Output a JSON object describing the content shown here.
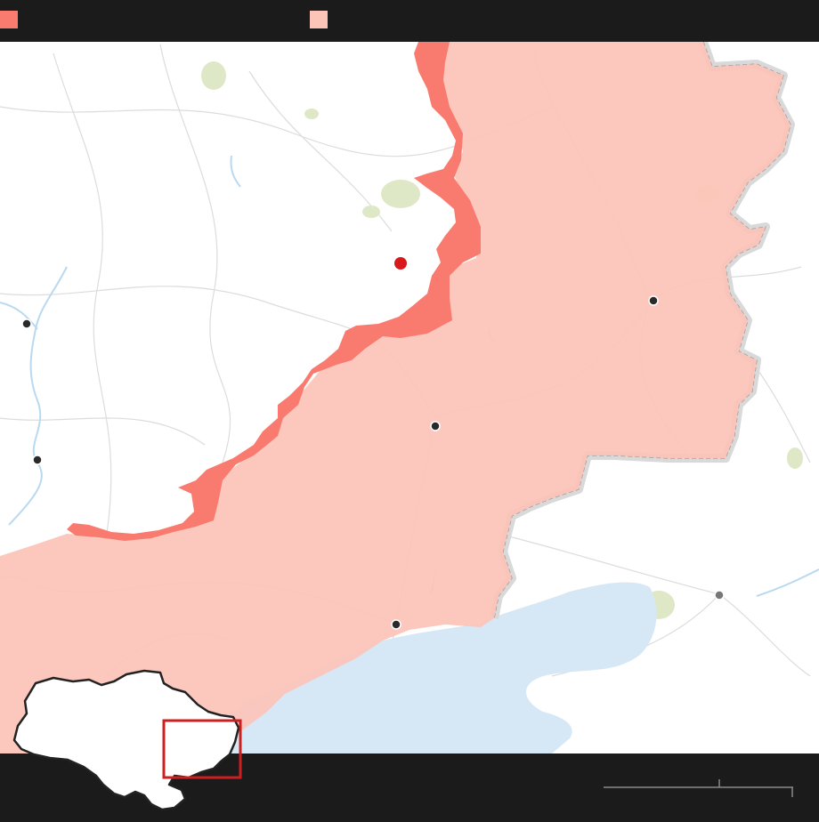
{
  "legend": {
    "items": [
      {
        "label": "",
        "color": "#f97b6f"
      },
      {
        "label": "",
        "color": "#fcc3b7"
      }
    ]
  },
  "colors": {
    "background_bar": "#1b1b1c",
    "frontline_band": "#f97b6f",
    "occupied_area": "#fcc3b7",
    "sea": "#d6e8f6",
    "river": "#b9d9f0",
    "road": "#dcdcdc",
    "border": "#bdbdbd",
    "urban": "#dfe8c6",
    "city_dot": "#2a2a2a",
    "highlight_dot": "#d7191c",
    "inset_frame": "#cc1f1f"
  },
  "map": {
    "cities": [
      {
        "name": "",
        "type": "city"
      },
      {
        "name": "",
        "type": "city"
      },
      {
        "name": "",
        "type": "city"
      },
      {
        "name": "",
        "type": "city"
      },
      {
        "name": "",
        "type": "city"
      },
      {
        "name": "",
        "type": "city-foreign"
      }
    ],
    "highlight": {
      "name": "",
      "type": "event-location"
    }
  },
  "scale": {
    "label": ""
  },
  "inset": {
    "icon": "ukraine-outline-icon"
  }
}
